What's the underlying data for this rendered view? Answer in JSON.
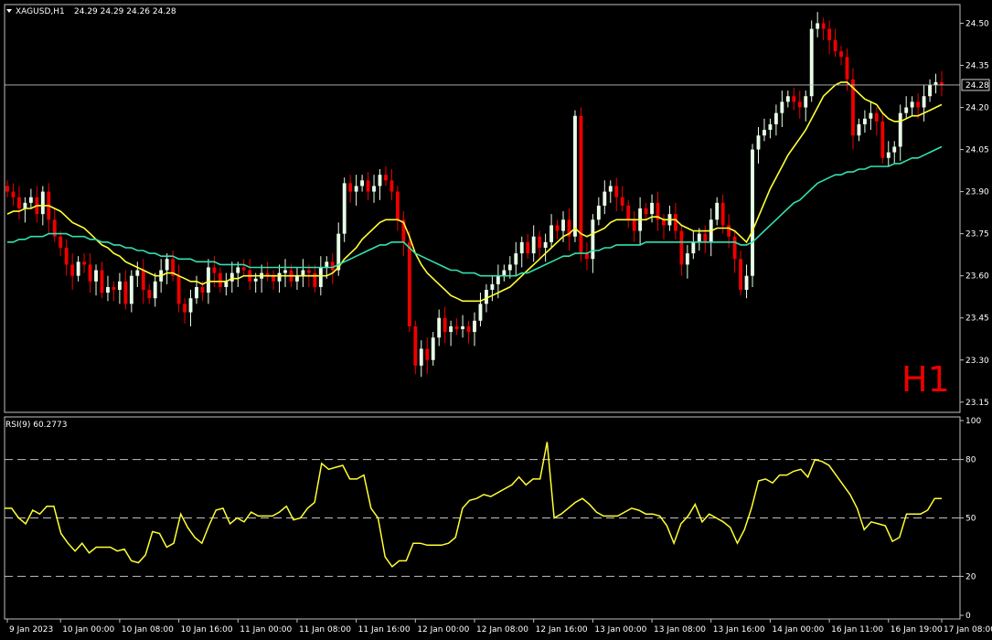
{
  "header": {
    "symbol": "XAGUSD,H1",
    "ohlc": "24.29 24.29 24.26 24.28"
  },
  "timeframe_label": "H1",
  "rsi_header": "RSI(9) 60.2773",
  "colors": {
    "background": "#000000",
    "frame": "#c0c0c0",
    "bull_candle": "#e8ffe8",
    "bear_candle": "#ee0000",
    "ma_fast": "#ffff33",
    "ma_slow": "#33e0b0",
    "rsi_line": "#ffff33",
    "timeframe": "#ee0000"
  },
  "chart_data": [
    {
      "type": "candlestick",
      "title": "XAGUSD,H1",
      "ylim": [
        23.12,
        24.56
      ],
      "y_ticks": [
        "24.50",
        "24.35",
        "24.20",
        "24.05",
        "23.90",
        "23.75",
        "23.60",
        "23.45",
        "23.30",
        "23.15"
      ],
      "y_tick_values": [
        24.5,
        24.35,
        24.2,
        24.05,
        23.9,
        23.75,
        23.6,
        23.45,
        23.3,
        23.15
      ],
      "current_price": 24.28,
      "current_price_label": "24.28",
      "x_labels": [
        "9 Jan 2023",
        "10 Jan 00:00",
        "10 Jan 08:00",
        "10 Jan 16:00",
        "11 Jan 00:00",
        "11 Jan 08:00",
        "11 Jan 16:00",
        "12 Jan 00:00",
        "12 Jan 08:00",
        "12 Jan 16:00",
        "13 Jan 00:00",
        "13 Jan 08:00",
        "13 Jan 16:00",
        "14 Jan 00:00",
        "16 Jan 11:00",
        "16 Jan 19:00",
        "17 Jan 08:00"
      ],
      "x_label_bar_index": [
        0,
        9,
        19,
        29,
        39,
        49,
        59,
        69,
        79,
        89,
        99,
        109,
        119,
        129,
        139,
        149,
        159
      ],
      "close": [
        23.9,
        23.88,
        23.84,
        23.86,
        23.88,
        23.82,
        23.9,
        23.8,
        23.74,
        23.7,
        23.64,
        23.6,
        23.65,
        23.64,
        23.58,
        23.62,
        23.54,
        23.56,
        23.55,
        23.58,
        23.5,
        23.6,
        23.62,
        23.55,
        23.52,
        23.58,
        23.62,
        23.66,
        23.6,
        23.5,
        23.47,
        23.52,
        23.56,
        23.54,
        23.63,
        23.61,
        23.56,
        23.58,
        23.61,
        23.63,
        23.62,
        23.58,
        23.59,
        23.61,
        23.6,
        23.58,
        23.61,
        23.62,
        23.58,
        23.6,
        23.62,
        23.61,
        23.56,
        23.63,
        23.65,
        23.62,
        23.75,
        23.93,
        23.9,
        23.92,
        23.94,
        23.9,
        23.92,
        23.96,
        23.94,
        23.9,
        23.8,
        23.72,
        23.42,
        23.28,
        23.34,
        23.3,
        23.38,
        23.45,
        23.4,
        23.42,
        23.41,
        23.42,
        23.4,
        23.44,
        23.5,
        23.55,
        23.57,
        23.6,
        23.62,
        23.64,
        23.68,
        23.72,
        23.68,
        23.74,
        23.7,
        23.72,
        23.78,
        23.76,
        23.8,
        23.74,
        24.17,
        23.68,
        23.66,
        23.8,
        23.85,
        23.9,
        23.92,
        23.88,
        23.85,
        23.8,
        23.76,
        23.84,
        23.82,
        23.86,
        23.8,
        23.78,
        23.82,
        23.76,
        23.64,
        23.68,
        23.72,
        23.75,
        23.72,
        23.8,
        23.86,
        23.78,
        23.74,
        23.66,
        23.55,
        23.6,
        24.05,
        24.1,
        24.12,
        24.14,
        24.18,
        24.22,
        24.24,
        24.22,
        24.2,
        24.24,
        24.48,
        24.5,
        24.48,
        24.44,
        24.4,
        24.38,
        24.3,
        24.1,
        24.14,
        24.16,
        24.18,
        24.15,
        24.02,
        24.04,
        24.06,
        24.18,
        24.2,
        24.22,
        24.2,
        24.24,
        24.28,
        24.29,
        24.28
      ],
      "series": [
        {
          "name": "MA fast",
          "values": [
            23.82,
            23.83,
            23.83,
            23.84,
            23.84,
            23.85,
            23.85,
            23.85,
            23.84,
            23.83,
            23.81,
            23.79,
            23.78,
            23.77,
            23.75,
            23.73,
            23.71,
            23.7,
            23.68,
            23.67,
            23.65,
            23.64,
            23.63,
            23.62,
            23.61,
            23.6,
            23.6,
            23.61,
            23.61,
            23.6,
            23.59,
            23.58,
            23.58,
            23.57,
            23.58,
            23.58,
            23.58,
            23.58,
            23.59,
            23.59,
            23.6,
            23.6,
            23.6,
            23.6,
            23.6,
            23.6,
            23.6,
            23.6,
            23.6,
            23.6,
            23.6,
            23.6,
            23.6,
            23.6,
            23.6,
            23.61,
            23.63,
            23.66,
            23.68,
            23.7,
            23.73,
            23.75,
            23.77,
            23.79,
            23.8,
            23.8,
            23.8,
            23.79,
            23.74,
            23.68,
            23.64,
            23.61,
            23.59,
            23.57,
            23.55,
            23.53,
            23.52,
            23.51,
            23.51,
            23.51,
            23.51,
            23.52,
            23.53,
            23.54,
            23.55,
            23.56,
            23.58,
            23.6,
            23.62,
            23.64,
            23.66,
            23.68,
            23.7,
            23.72,
            23.74,
            23.75,
            23.77,
            23.75,
            23.74,
            23.75,
            23.76,
            23.77,
            23.79,
            23.8,
            23.8,
            23.8,
            23.8,
            23.8,
            23.8,
            23.81,
            23.81,
            23.8,
            23.8,
            23.8,
            23.78,
            23.77,
            23.76,
            23.76,
            23.76,
            23.76,
            23.77,
            23.77,
            23.77,
            23.76,
            23.74,
            23.72,
            23.76,
            23.81,
            23.86,
            23.91,
            23.95,
            23.99,
            24.03,
            24.06,
            24.09,
            24.12,
            24.16,
            24.2,
            24.24,
            24.26,
            24.28,
            24.29,
            24.29,
            24.27,
            24.25,
            24.23,
            24.22,
            24.21,
            24.18,
            24.16,
            24.15,
            24.15,
            24.16,
            24.17,
            24.17,
            24.18,
            24.19,
            24.2,
            24.21
          ]
        },
        {
          "name": "MA slow",
          "values": [
            23.72,
            23.72,
            23.73,
            23.73,
            23.74,
            23.74,
            23.74,
            23.75,
            23.75,
            23.75,
            23.75,
            23.74,
            23.74,
            23.74,
            23.73,
            23.73,
            23.72,
            23.72,
            23.71,
            23.71,
            23.7,
            23.7,
            23.69,
            23.69,
            23.68,
            23.68,
            23.67,
            23.67,
            23.67,
            23.66,
            23.66,
            23.66,
            23.65,
            23.65,
            23.65,
            23.65,
            23.64,
            23.64,
            23.64,
            23.64,
            23.64,
            23.63,
            23.63,
            23.63,
            23.63,
            23.63,
            23.63,
            23.63,
            23.63,
            23.63,
            23.63,
            23.63,
            23.63,
            23.63,
            23.63,
            23.63,
            23.64,
            23.65,
            23.66,
            23.67,
            23.68,
            23.69,
            23.7,
            23.71,
            23.71,
            23.72,
            23.72,
            23.72,
            23.7,
            23.68,
            23.67,
            23.66,
            23.65,
            23.64,
            23.63,
            23.62,
            23.62,
            23.61,
            23.61,
            23.61,
            23.6,
            23.6,
            23.6,
            23.6,
            23.6,
            23.6,
            23.6,
            23.61,
            23.61,
            23.62,
            23.63,
            23.64,
            23.65,
            23.66,
            23.67,
            23.67,
            23.68,
            23.68,
            23.68,
            23.69,
            23.69,
            23.7,
            23.7,
            23.71,
            23.71,
            23.71,
            23.71,
            23.71,
            23.72,
            23.72,
            23.72,
            23.72,
            23.72,
            23.72,
            23.72,
            23.72,
            23.72,
            23.72,
            23.72,
            23.72,
            23.72,
            23.72,
            23.72,
            23.72,
            23.71,
            23.71,
            23.72,
            23.74,
            23.76,
            23.78,
            23.8,
            23.82,
            23.84,
            23.86,
            23.87,
            23.89,
            23.91,
            23.93,
            23.94,
            23.95,
            23.96,
            23.96,
            23.97,
            23.97,
            23.98,
            23.98,
            23.99,
            23.99,
            23.99,
            23.99,
            24.0,
            24.0,
            24.01,
            24.02,
            24.02,
            24.03,
            24.04,
            24.05,
            24.06
          ]
        }
      ]
    },
    {
      "type": "line",
      "title": "RSI(9) 60.2773",
      "ylim": [
        0,
        100
      ],
      "y_ticks": [
        "100",
        "80",
        "50",
        "20",
        "0"
      ],
      "y_tick_values": [
        100,
        80,
        50,
        20,
        0
      ],
      "levels": [
        80,
        50,
        20
      ],
      "series": [
        {
          "name": "RSI(9)",
          "values": [
            55,
            55,
            50,
            47,
            54,
            52,
            56,
            56,
            42,
            37,
            33,
            37,
            32,
            35,
            35,
            35,
            33,
            34,
            28,
            27,
            31,
            43,
            42,
            35,
            37,
            52,
            45,
            40,
            37,
            46,
            54,
            55,
            47,
            50,
            48,
            53,
            51,
            51,
            51,
            53,
            56,
            49,
            50,
            55,
            58,
            78,
            75,
            76,
            77,
            70,
            70,
            72,
            55,
            50,
            30,
            25,
            28,
            28,
            37,
            37,
            36,
            36,
            36,
            37,
            40,
            55,
            59,
            60,
            62,
            61,
            63,
            65,
            67,
            71,
            67,
            70,
            70,
            89,
            50,
            52,
            55,
            58,
            60,
            57,
            53,
            51,
            51,
            51,
            53,
            55,
            54,
            52,
            52,
            51,
            46,
            37,
            47,
            51,
            57,
            48,
            52,
            50,
            48,
            45,
            37,
            44,
            55,
            69,
            70,
            68,
            72,
            72,
            74,
            75,
            71,
            80,
            79,
            77,
            72,
            67,
            62,
            55,
            44,
            48,
            47,
            46,
            38,
            40,
            52,
            52,
            52,
            54,
            60,
            60
          ]
        }
      ]
    }
  ]
}
